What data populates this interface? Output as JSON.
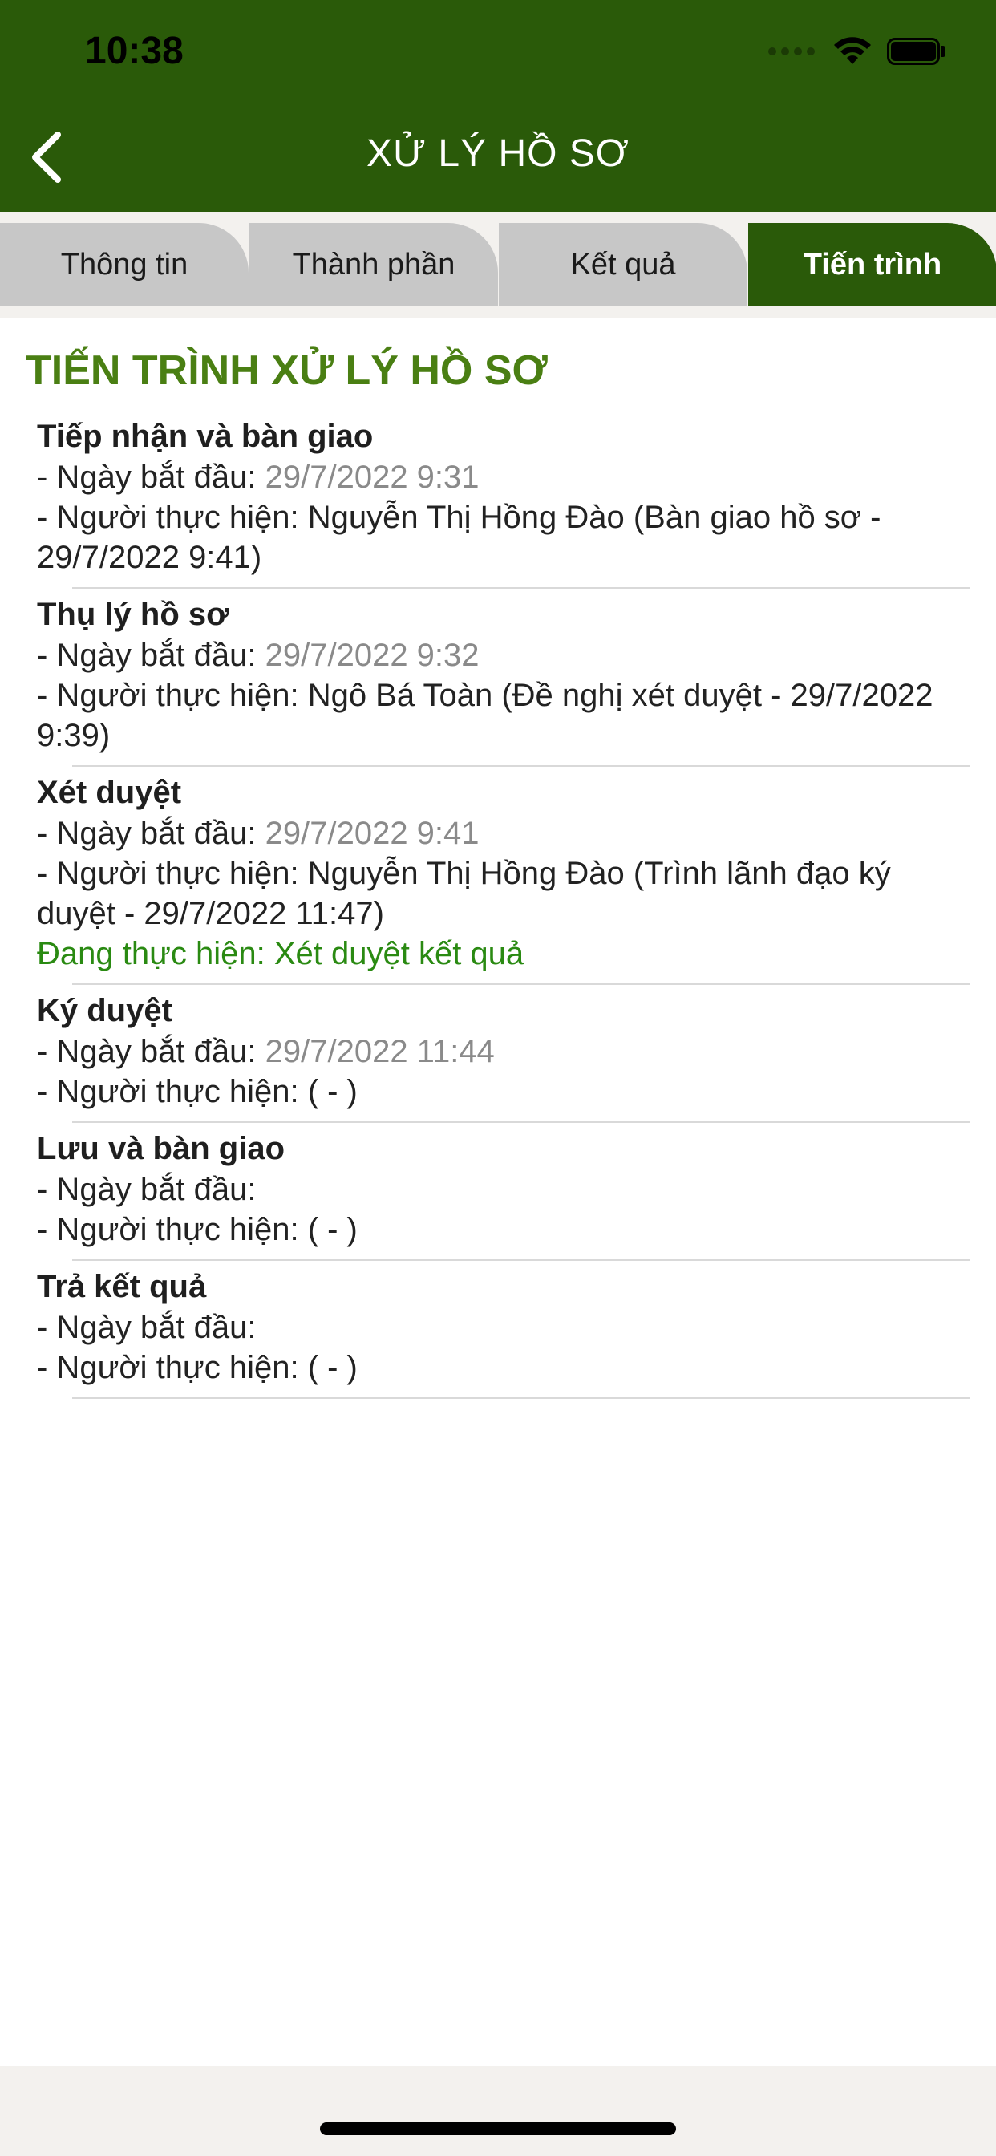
{
  "status_bar": {
    "time": "10:38"
  },
  "nav": {
    "title": "XỬ LÝ HỒ SƠ"
  },
  "tabs": [
    {
      "label": "Thông tin"
    },
    {
      "label": "Thành phần"
    },
    {
      "label": "Kết quả"
    },
    {
      "label": "Tiến trình"
    }
  ],
  "section_title": "TIẾN TRÌNH XỬ LÝ HỒ SƠ",
  "labels": {
    "start_date": "- Ngày bắt đầu: ",
    "performer": "- Người thực hiện: "
  },
  "steps": [
    {
      "title": "Tiếp nhận và bàn giao",
      "start_date": "29/7/2022 9:31",
      "performer": "Nguyễn Thị Hồng Đào (Bàn giao hồ sơ - 29/7/2022 9:41)"
    },
    {
      "title": "Thụ lý hồ sơ",
      "start_date": "29/7/2022 9:32",
      "performer": "Ngô Bá Toàn (Đề nghị xét duyệt - 29/7/2022 9:39)"
    },
    {
      "title": "Xét duyệt",
      "start_date": "29/7/2022 9:41",
      "performer": "Nguyễn Thị Hồng Đào (Trình lãnh đạo ký duyệt - 29/7/2022 11:47)",
      "status": "Đang thực hiện: Xét duyệt kết quả"
    },
    {
      "title": "Ký duyệt",
      "start_date": "29/7/2022 11:44",
      "performer": " ( - )"
    },
    {
      "title": "Lưu và bàn giao",
      "start_date": "",
      "performer": " ( - )"
    },
    {
      "title": "Trả kết quả",
      "start_date": "",
      "performer": " ( - )"
    }
  ],
  "colors": {
    "header": "#2a5a09",
    "accent": "#4a7f13",
    "status": "#2a8a12",
    "tab_inactive": "#c7c7c7"
  }
}
